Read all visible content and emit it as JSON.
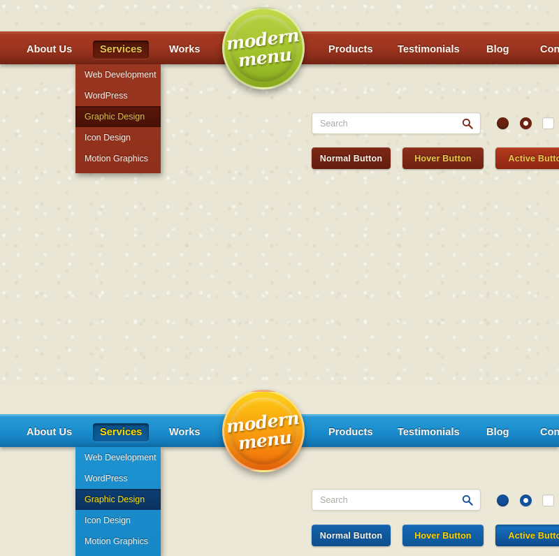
{
  "theme": {
    "background": "#ece8d8",
    "red_accent": "#9e3520",
    "blue_accent": "#1c8fcf",
    "badge_green": "#a3c32c",
    "badge_orange": "#f99a0d",
    "highlight_gold": "#e6c64e",
    "highlight_yellow": "#ffe000"
  },
  "variants": [
    {
      "id": "red",
      "nav": {
        "items": [
          {
            "label": "About Us",
            "state": "normal"
          },
          {
            "label": "Services",
            "state": "active"
          },
          {
            "label": "Works",
            "state": "normal"
          },
          {
            "label": "Products",
            "state": "normal"
          },
          {
            "label": "Testimonials",
            "state": "normal"
          },
          {
            "label": "Blog",
            "state": "normal"
          },
          {
            "label": "Conta",
            "state": "normal"
          }
        ]
      },
      "dropdown": {
        "items": [
          {
            "label": "Web Development",
            "selected": false
          },
          {
            "label": "WordPress",
            "selected": false
          },
          {
            "label": "Graphic Design",
            "selected": true
          },
          {
            "label": "Icon Design",
            "selected": false
          },
          {
            "label": "Motion Graphics",
            "selected": false
          }
        ]
      },
      "badge": {
        "line1": "modern",
        "line2": "menu",
        "icon": "badge-seal-icon"
      },
      "search": {
        "value": "",
        "placeholder": "Search",
        "icon": "search-icon"
      },
      "controls": [
        {
          "type": "radio",
          "name": "radio-selected",
          "checked": true
        },
        {
          "type": "radio",
          "name": "radio-unselected",
          "checked": false
        },
        {
          "type": "checkbox",
          "name": "checkbox-unchecked",
          "checked": false
        }
      ],
      "buttons": [
        {
          "label": "Normal Button",
          "state": "normal"
        },
        {
          "label": "Hover Button",
          "state": "hover"
        },
        {
          "label": "Active Butto",
          "state": "active"
        }
      ]
    },
    {
      "id": "blue",
      "nav": {
        "items": [
          {
            "label": "About Us",
            "state": "normal"
          },
          {
            "label": "Services",
            "state": "active"
          },
          {
            "label": "Works",
            "state": "normal"
          },
          {
            "label": "Products",
            "state": "normal"
          },
          {
            "label": "Testimonials",
            "state": "normal"
          },
          {
            "label": "Blog",
            "state": "normal"
          },
          {
            "label": "Conta",
            "state": "normal"
          }
        ]
      },
      "dropdown": {
        "items": [
          {
            "label": "Web Development",
            "selected": false
          },
          {
            "label": "WordPress",
            "selected": false
          },
          {
            "label": "Graphic Design",
            "selected": true
          },
          {
            "label": "Icon Design",
            "selected": false
          },
          {
            "label": "Motion Graphics",
            "selected": false
          }
        ]
      },
      "badge": {
        "line1": "modern",
        "line2": "menu",
        "icon": "badge-seal-icon"
      },
      "search": {
        "value": "",
        "placeholder": "Search",
        "icon": "search-icon"
      },
      "controls": [
        {
          "type": "radio",
          "name": "radio-selected",
          "checked": true
        },
        {
          "type": "radio",
          "name": "radio-unselected",
          "checked": false
        },
        {
          "type": "checkbox",
          "name": "checkbox-unchecked",
          "checked": false
        }
      ],
      "buttons": [
        {
          "label": "Normal Button",
          "state": "normal"
        },
        {
          "label": "Hover Button",
          "state": "hover"
        },
        {
          "label": "Active Butto",
          "state": "active"
        }
      ]
    }
  ]
}
